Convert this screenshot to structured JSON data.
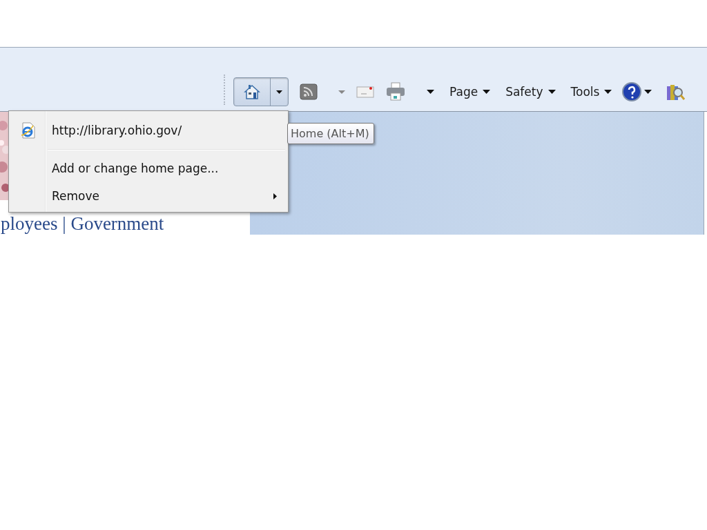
{
  "toolbar": {
    "items": [
      {
        "kind": "home",
        "pressed": true
      },
      {
        "kind": "feeds"
      },
      {
        "kind": "mail"
      },
      {
        "kind": "print"
      },
      {
        "kind": "menu",
        "label": "Page"
      },
      {
        "kind": "menu",
        "label": "Safety"
      },
      {
        "kind": "menu",
        "label": "Tools"
      },
      {
        "kind": "help"
      },
      {
        "kind": "research"
      }
    ]
  },
  "page": {
    "heading_fragment": "ployees | Government"
  },
  "home_menu": {
    "items": [
      {
        "kind": "link",
        "label": "http://library.ohio.gov/"
      },
      {
        "kind": "separator"
      },
      {
        "kind": "action",
        "label": "Add or change home page..."
      },
      {
        "kind": "submenu",
        "label": "Remove"
      }
    ]
  },
  "tooltip": {
    "text": "Home (Alt+M)"
  }
}
